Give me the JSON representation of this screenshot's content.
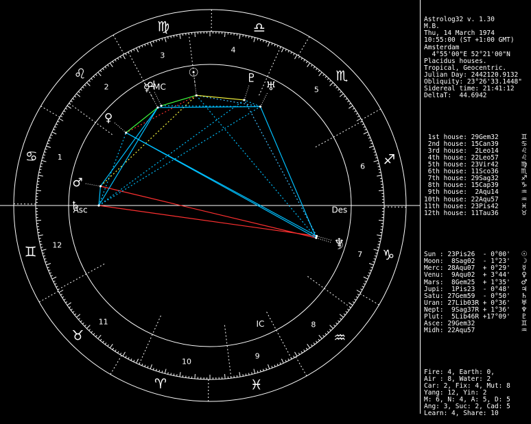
{
  "header": [
    "Astrolog32 v. 1.30",
    "M.B.",
    "Thu, 14 March 1974",
    "10:55:00 (ST +1:00 GMT)",
    "Amsterdam",
    "  4°55'00\"E 52°21'00\"N",
    "Placidus houses.",
    "Tropical, Geocentric.",
    "Julian Day: 2442120.9132",
    "Obliquity: 23°26'33.1448\"",
    "Sidereal time: 21:41:12",
    "DeltaT:  44.6942"
  ],
  "houses": [
    {
      "text": " 1st house: 29Gem32",
      "glyph": "♊"
    },
    {
      "text": " 2nd house: 15Can39",
      "glyph": "♋"
    },
    {
      "text": " 3rd house:  2Leo14",
      "glyph": "♌"
    },
    {
      "text": " 4th house: 22Leo57",
      "glyph": "♌"
    },
    {
      "text": " 5th house: 23Vir42",
      "glyph": "♍"
    },
    {
      "text": " 6th house: 11Sco36",
      "glyph": "♏"
    },
    {
      "text": " 7th house: 29Sag32",
      "glyph": "♐"
    },
    {
      "text": " 8th house: 15Cap39",
      "glyph": "♑"
    },
    {
      "text": " 9th house:  2Aqu14",
      "glyph": "♒"
    },
    {
      "text": "10th house: 22Aqu57",
      "glyph": "♒"
    },
    {
      "text": "11th house: 23Pis42",
      "glyph": "♓"
    },
    {
      "text": "12th house: 11Tau36",
      "glyph": "♉"
    }
  ],
  "planets": [
    {
      "text": "Sun : 23Pis26  - 0°00'",
      "glyph": "☉"
    },
    {
      "text": "Moon:  8Sag02  - 1°23'",
      "glyph": "☽"
    },
    {
      "text": "Merc: 28Aqu07  + 0°29'",
      "glyph": "☿"
    },
    {
      "text": "Venu:  9Aqu02  + 3°44'",
      "glyph": "♀"
    },
    {
      "text": "Mars:  8Gem25  + 1°35'",
      "glyph": "♂"
    },
    {
      "text": "Jupi:  1Pis23  - 0°48'",
      "glyph": "♃"
    },
    {
      "text": "Satu: 27Gem59  - 0°50'",
      "glyph": "♄"
    },
    {
      "text": "Uran: 27Lib03R + 0°36'",
      "glyph": "♅"
    },
    {
      "text": "Nept:  9Sag37R + 1°36'",
      "glyph": "♆"
    },
    {
      "text": "Plut:  5Lib46R +17°09'",
      "glyph": "♇"
    },
    {
      "text": "Asce: 29Gem32",
      "glyph": "♊"
    },
    {
      "text": "Midh: 22Aqu57",
      "glyph": "♒"
    }
  ],
  "stats": [
    "Fire: 4, Earth: 0,",
    "Air : 8, Water: 2",
    "Car: 2, Fix: 4, Mut: 8",
    "Yang: 12, Yin: 2",
    "M: 6, N: 4, A: 5, D: 5",
    "Ang: 3, Suc: 2, Cad: 5",
    "Learn: 4, Share: 10"
  ],
  "wheel": {
    "sign_glyphs": [
      "♈",
      "♉",
      "♊",
      "♋",
      "♌",
      "♍",
      "♎",
      "♏",
      "♐",
      "♑",
      "♒",
      "♓"
    ],
    "house_numbers": [
      "1",
      "2",
      "3",
      "4",
      "5",
      "6",
      "7",
      "8",
      "9",
      "10",
      "11",
      "12"
    ],
    "asc_label": "Asc",
    "des_label": "Des",
    "mc_label": "MC",
    "ic_label": "IC"
  },
  "colors": {
    "background": "#000000",
    "wheel": "#ffffff",
    "trine": "#00c0ff",
    "square": "#ff3030",
    "sextile": "#40c0ff",
    "yellow": "#ffff40",
    "green": "#40ff40"
  }
}
